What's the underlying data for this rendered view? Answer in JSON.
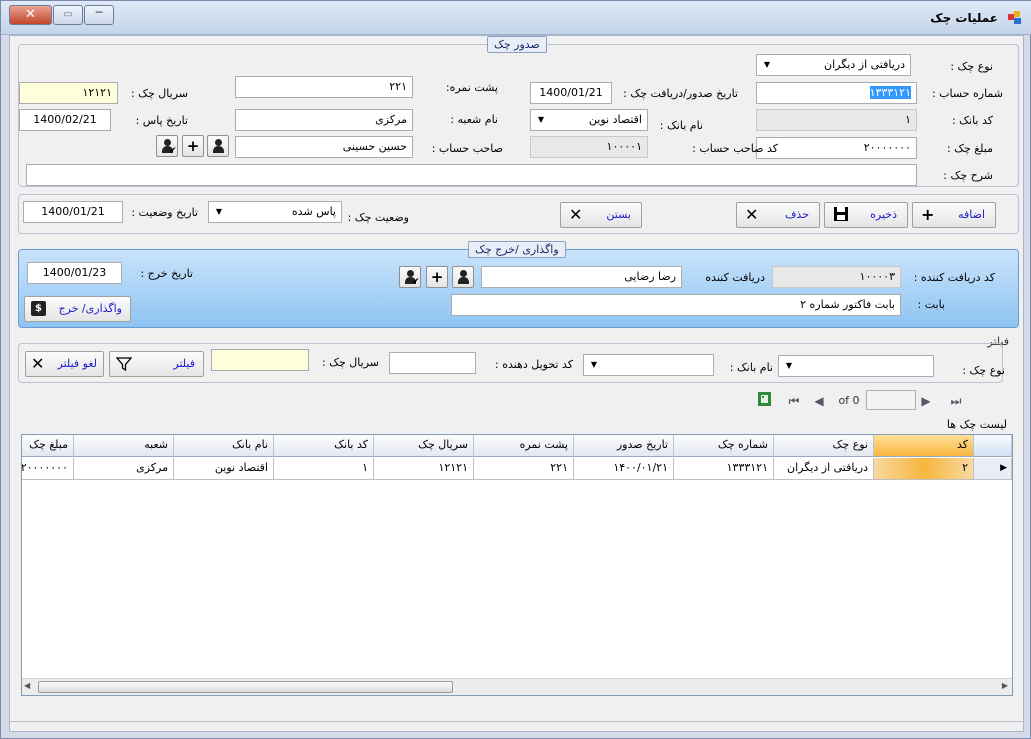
{
  "window": {
    "title": "عملیات چک",
    "close_glyph": "✕",
    "max_glyph": "▭",
    "min_glyph": "─"
  },
  "issue_group": {
    "legend": "صدور چک",
    "check_type": {
      "label": "نوع چک :",
      "value": "دریافتی از دیگران"
    },
    "account_no": {
      "label": "شماره حساب :",
      "value": "۱۳۳۳۱۲۱"
    },
    "issue_date": {
      "label": "تاریخ صدور/دریافت  چک  :",
      "value": "1400/01/21"
    },
    "back_no": {
      "label": "پشت نمره:",
      "value": "۲۲۱"
    },
    "serial": {
      "label": "سریال چک :",
      "value": "۱۲۱۲۱"
    },
    "bank_code": {
      "label": "کد بانک :",
      "value": "۱"
    },
    "bank_name": {
      "label": "نام بانک :",
      "value": "اقتصاد نوین"
    },
    "branch_name": {
      "label": "نام شعبه :",
      "value": "مرکزی"
    },
    "pass_date": {
      "label": "تاریخ پاس :",
      "value": "1400/02/21"
    },
    "amount": {
      "label": "مبلغ چک :",
      "value": "۲۰۰۰۰۰۰۰"
    },
    "owner_code": {
      "label": "کد صاحب حساب :",
      "value": "۱۰۰۰۰۱"
    },
    "owner": {
      "label": "صاحب حساب :",
      "value": "حسین حسینی"
    },
    "description": {
      "label": "شرح چک :",
      "value": ""
    }
  },
  "actions": {
    "add": "اضافه",
    "save": "ذخیره",
    "delete": "حذف",
    "close": "بستن",
    "status_label": "وضعیت چک :",
    "status_value": "پاس شده",
    "status_date_label": "تاریخ وضعیت :",
    "status_date_value": "1400/01/21"
  },
  "assign_group": {
    "legend": "واگذاری /خرج چک",
    "receiver_code_label": "کد دریافت کننده  :",
    "receiver_code": "۱۰۰۰۰۳",
    "receiver_label": "دریافت کننده",
    "receiver": "رضا رضایی",
    "for_label": "بابت  :",
    "for_value": "بابت فاکتور شماره ۲",
    "spend_date_label": "تاریخ خرج :",
    "spend_date": "1400/01/23",
    "assign_button": "واگذاری/ خرج",
    "assign_icon": "$"
  },
  "filter": {
    "title": "فیلتر",
    "check_type_label": "نوع چک :",
    "bank_label": "نام بانک :",
    "deliverer_label": "کد تحویل دهنده :",
    "serial_label": "سریال چک :",
    "filter_button": "فیلتر",
    "clear_button": "لغو فیلتر"
  },
  "pager": {
    "of": "of 0",
    "page": ""
  },
  "list": {
    "title": "لیست چک ها",
    "columns": [
      "کد",
      "نوع چک",
      "شماره چک",
      "تاریخ صدور",
      "پشت نمره",
      "سریال چک",
      "کد بانک",
      "نام بانک",
      "شعبه",
      "مبلغ چک"
    ],
    "rows": [
      [
        "۲",
        "دریافتی از دیگران",
        "۱۳۳۳۱۲۱",
        "۱۴۰۰/۰۱/۲۱",
        "۲۲۱",
        "۱۲۱۲۱",
        "۱",
        "اقتصاد نوین",
        "مرکزی",
        "۲۰۰۰۰۰۰۰"
      ]
    ]
  }
}
